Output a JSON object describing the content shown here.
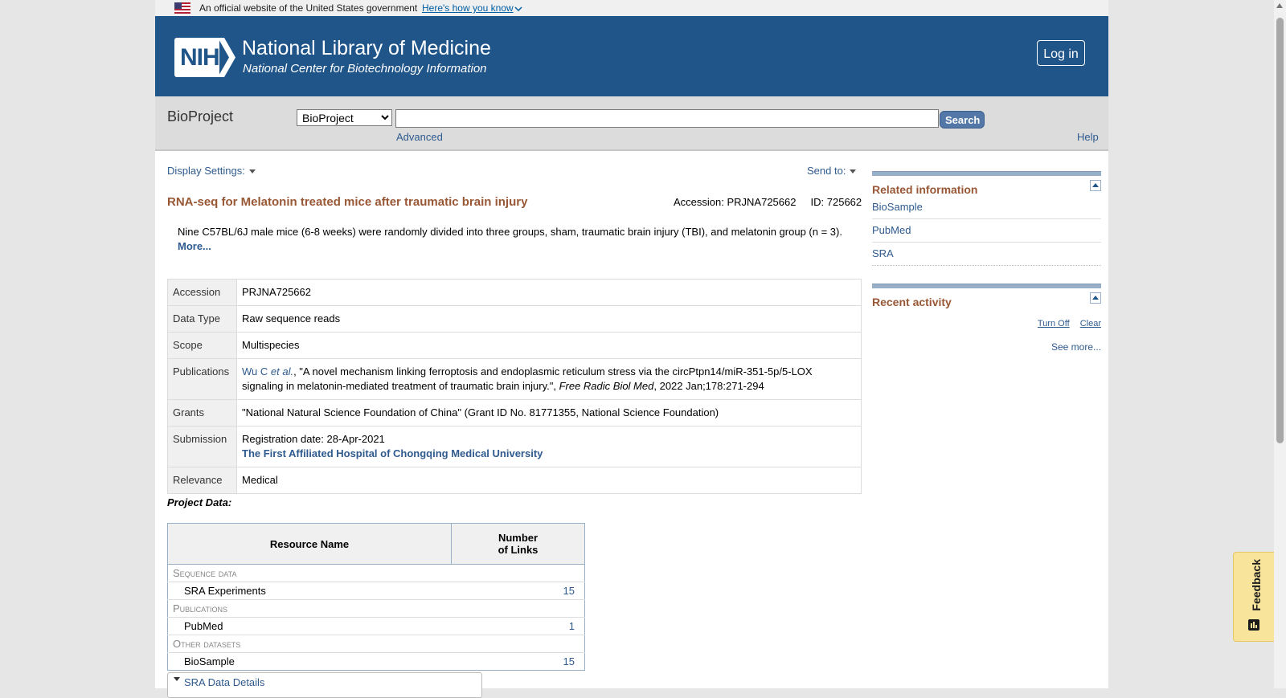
{
  "gov_banner": {
    "text": "An official website of the United States government",
    "how_link": "Here's how you know"
  },
  "header": {
    "title": "National Library of Medicine",
    "subtitle": "National Center for Biotechnology Information",
    "logo_text": "NIH",
    "login_label": "Log in"
  },
  "search": {
    "db_name": "BioProject",
    "selected_db": "BioProject",
    "query": "",
    "button_label": "Search",
    "advanced_label": "Advanced",
    "help_label": "Help"
  },
  "toolbar": {
    "display_settings": "Display Settings:",
    "send_to": "Send to:"
  },
  "record": {
    "title": "RNA-seq for Melatonin treated mice after traumatic brain injury",
    "accession_info": "Accession: PRJNA725662     ID: 725662",
    "description": "Nine C57BL/6J male mice (6-8 weeks) were randomly divided into three groups, sham, traumatic brain injury (TBI), and melatonin group (n = 3).",
    "more_label": "More...",
    "rows": {
      "accession": {
        "label": "Accession",
        "value": "PRJNA725662"
      },
      "data_type": {
        "label": "Data Type",
        "value": "Raw sequence reads"
      },
      "scope": {
        "label": "Scope",
        "value": "Multispecies"
      },
      "publications": {
        "label": "Publications",
        "author_link": "Wu C",
        "et_al": "et al.",
        "citation": ", \"A novel mechanism linking ferroptosis and endoplasmic reticulum stress via the circPtpn14/miR-351-5p/5-LOX signaling in melatonin-mediated treatment of traumatic brain injury.\", ",
        "journal": "Free Radic Biol Med",
        "date": ", 2022 Jan;178:271-294"
      },
      "grants": {
        "label": "Grants",
        "value": "\"National Natural Science Foundation of China\" (Grant ID No. 81771355, National Science Foundation)"
      },
      "submission": {
        "label": "Submission",
        "reg_date": "Registration date: 28-Apr-2021",
        "organization": "The First Affiliated Hospital of Chongqing Medical University"
      },
      "relevance": {
        "label": "Relevance",
        "value": "Medical"
      }
    }
  },
  "project_data": {
    "label": "Project Data:",
    "col_resource": "Resource Name",
    "col_links_1": "Number",
    "col_links_2": "of Links",
    "sections": [
      {
        "name": "Sequence data",
        "item": "SRA Experiments",
        "count": "15"
      },
      {
        "name": "Publications",
        "item": "PubMed",
        "count": "1"
      },
      {
        "name": "Other datasets",
        "item": "BioSample",
        "count": "15"
      }
    ],
    "sra_details_label": "SRA Data Details"
  },
  "sidebar": {
    "related": {
      "title": "Related information",
      "items": [
        "BioSample",
        "PubMed",
        "SRA"
      ]
    },
    "recent": {
      "title": "Recent activity",
      "turn_off": "Turn Off",
      "clear": "Clear",
      "see_more": "See more..."
    }
  },
  "feedback_label": "Feedback"
}
